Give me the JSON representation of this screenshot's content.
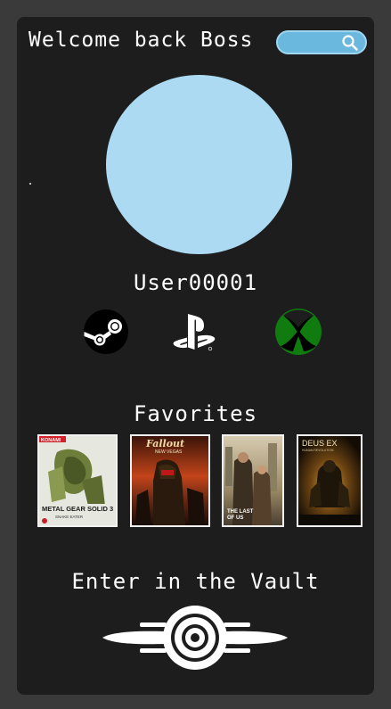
{
  "header": {
    "welcome_text": "Welcome back Boss",
    "search_placeholder": ""
  },
  "profile": {
    "username": "User00001",
    "avatar_color": "#abdaf2"
  },
  "platforms": [
    {
      "name": "steam-icon"
    },
    {
      "name": "playstation-icon"
    },
    {
      "name": "xbox-icon"
    }
  ],
  "favorites": {
    "title": "Favorites",
    "games": [
      {
        "cover": "metal-gear-solid-3-cover",
        "logo": "KONAMI",
        "title_line1": "METAL GEAR SOLID 3",
        "title_line2": "SNAKE EATER"
      },
      {
        "cover": "fallout-new-vegas-cover",
        "title_line1": "Fallout",
        "title_line2": "NEW VEGAS"
      },
      {
        "cover": "the-last-of-us-cover",
        "title_line1": "THE LAST",
        "title_line2": "OF US"
      },
      {
        "cover": "deus-ex-cover",
        "title_line1": "DEUS EX",
        "title_line2": "HUMAN REVOLUTION"
      }
    ]
  },
  "vault": {
    "label": "Enter in the Vault"
  },
  "colors": {
    "background": "#1d1d1d",
    "frame": "#3a3a3a",
    "accent": "#6bb8de",
    "xbox_green": "#107c10"
  }
}
